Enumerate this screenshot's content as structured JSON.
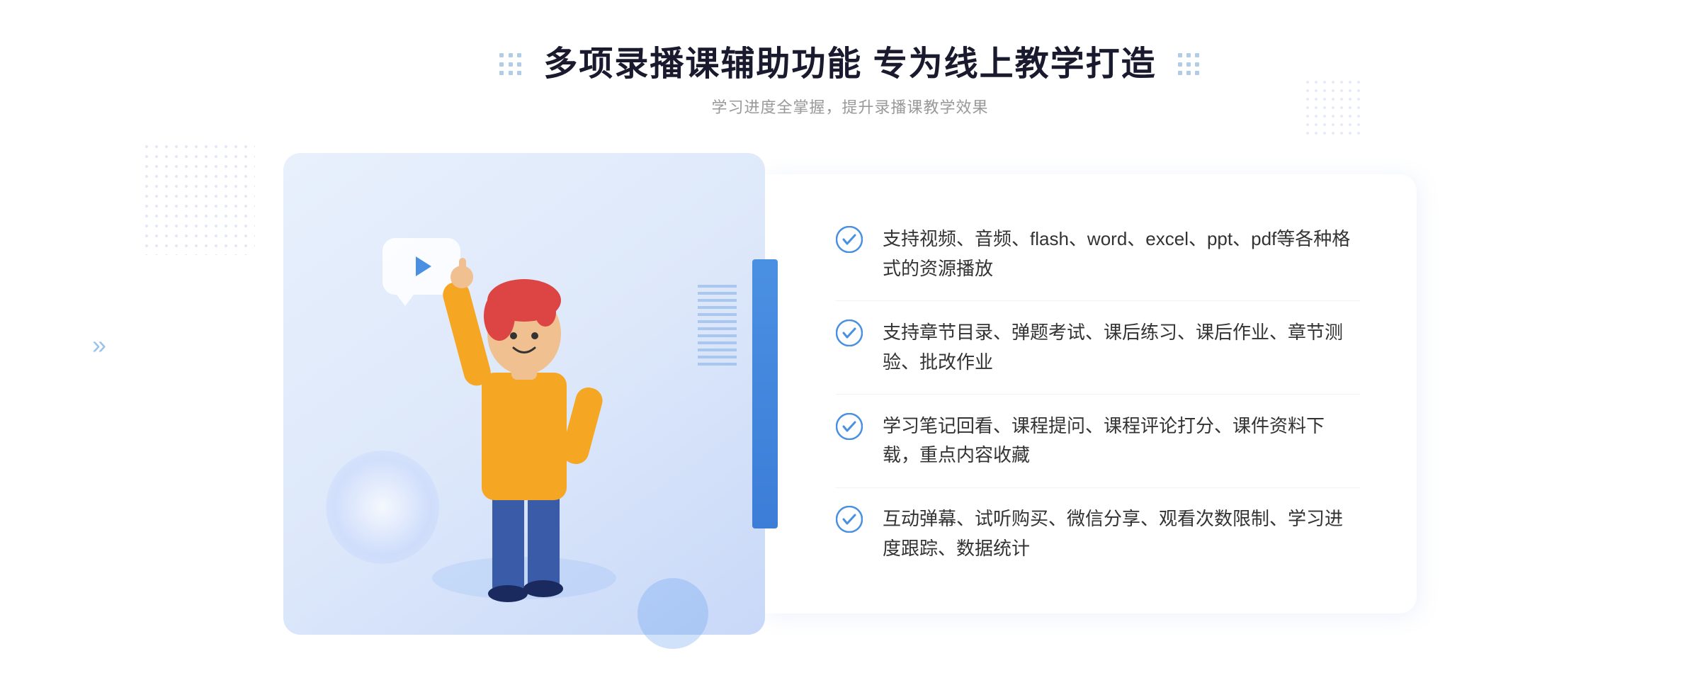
{
  "header": {
    "title": "多项录播课辅助功能 专为线上教学打造",
    "subtitle": "学习进度全掌握，提升录播课教学效果"
  },
  "features": [
    {
      "id": "feature-1",
      "text": "支持视频、音频、flash、word、excel、ppt、pdf等各种格式的资源播放"
    },
    {
      "id": "feature-2",
      "text": "支持章节目录、弹题考试、课后练习、课后作业、章节测验、批改作业"
    },
    {
      "id": "feature-3",
      "text": "学习笔记回看、课程提问、课程评论打分、课件资料下载，重点内容收藏"
    },
    {
      "id": "feature-4",
      "text": "互动弹幕、试听购买、微信分享、观看次数限制、学习进度跟踪、数据统计"
    }
  ],
  "decorations": {
    "left_arrow": "»",
    "check_color": "#4a90e2",
    "accent_color": "#4a90e2"
  }
}
